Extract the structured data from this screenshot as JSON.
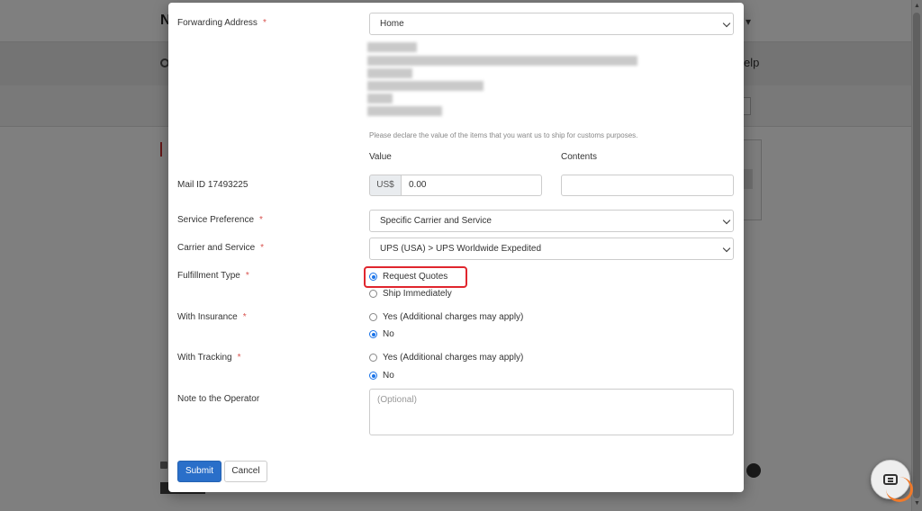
{
  "form": {
    "forwarding_address": {
      "label": "Forwarding Address",
      "required_mark": "*",
      "selected": "Home"
    },
    "customs_hint": "Please declare the value of the items that you want us to ship for customs purposes.",
    "value_header": "Value",
    "contents_header": "Contents",
    "mail_id_label": "Mail ID 17493225",
    "currency_prefix": "US$",
    "value": "0.00",
    "contents_value": "",
    "service_preference": {
      "label": "Service Preference",
      "required_mark": "*",
      "selected": "Specific Carrier and Service"
    },
    "carrier_service": {
      "label": "Carrier and Service",
      "required_mark": "*",
      "selected": "UPS (USA) > UPS Worldwide Expedited"
    },
    "fulfillment_type": {
      "label": "Fulfillment Type",
      "required_mark": "*",
      "options": [
        {
          "label": "Request Quotes",
          "checked": true
        },
        {
          "label": "Ship Immediately",
          "checked": false
        }
      ]
    },
    "insurance": {
      "label": "With Insurance",
      "required_mark": "*",
      "options": [
        {
          "label": "Yes (Additional charges may apply)",
          "checked": false
        },
        {
          "label": "No",
          "checked": true
        }
      ]
    },
    "tracking": {
      "label": "With Tracking",
      "required_mark": "*",
      "options": [
        {
          "label": "Yes (Additional charges may apply)",
          "checked": false
        },
        {
          "label": "No",
          "checked": true
        }
      ]
    },
    "note": {
      "label": "Note to the Operator",
      "placeholder": "(Optional)"
    },
    "submit_label": "Submit",
    "cancel_label": "Cancel"
  },
  "background": {
    "logo_letter": "N",
    "help_label": "elp"
  },
  "colors": {
    "primary": "#2a6fc9",
    "required": "#d9534f",
    "highlight": "#e0262e",
    "radio_checked": "#1a73e8",
    "chat_accent": "#f07a2a"
  }
}
